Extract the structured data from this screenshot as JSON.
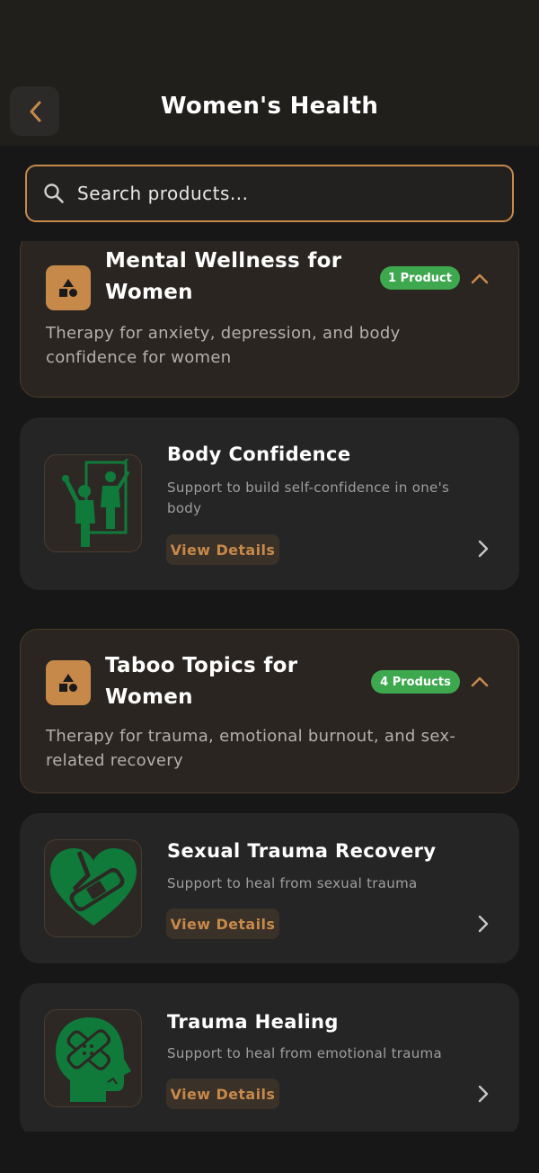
{
  "header": {
    "title": "Women's Health",
    "back_icon": "chevron-left-icon"
  },
  "search": {
    "placeholder": "Search products...",
    "value": "",
    "icon": "search-icon"
  },
  "colors": {
    "accent": "#c7894a",
    "badge_green": "#3ea84f",
    "product_green": "#0f7a3a",
    "background": "#171717"
  },
  "categories": [
    {
      "title": "Mental Wellness for Women",
      "badge": "1 Product",
      "description": "Therapy for anxiety, depression, and body confidence for women",
      "icon": "shapes-icon",
      "expanded": true,
      "products": [
        {
          "name": "Body Confidence",
          "description": "Support to build self-confidence in one's body",
          "button": "View Details",
          "icon": "mirror-figures-icon"
        }
      ]
    },
    {
      "title": "Taboo Topics for Women",
      "badge": "4 Products",
      "description": "Therapy for trauma, emotional burnout, and sex-related recovery",
      "icon": "shapes-icon",
      "expanded": true,
      "products": [
        {
          "name": "Sexual Trauma Recovery",
          "description": "Support to heal from sexual trauma",
          "button": "View Details",
          "icon": "bandaged-heart-icon"
        },
        {
          "name": "Trauma Healing",
          "description": "Support to heal from emotional trauma",
          "button": "View Details",
          "icon": "bandaged-head-icon"
        }
      ]
    }
  ]
}
